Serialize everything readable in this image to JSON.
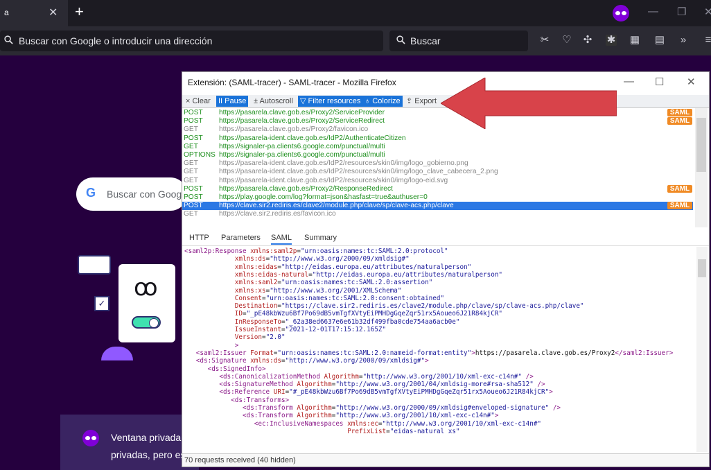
{
  "browser": {
    "tab_title": "a",
    "url_placeholder": "Buscar con Google o introducir una dirección",
    "search_placeholder": "Buscar"
  },
  "page": {
    "google_search_label": "Buscar con Goog",
    "private_notice_line1": "Ventana privada:",
    "private_notice_line2": "privadas, pero es"
  },
  "tracer": {
    "window_title": "Extensión: (SAML-tracer) - SAML-tracer - Mozilla Firefox",
    "toolbar": {
      "clear": "× Clear",
      "pause": "II Pause",
      "autoscroll": "± Autoscroll",
      "filter": "▽ Filter resources",
      "colorize": "♁ Colorize",
      "export": "⇪ Export"
    },
    "requests": [
      {
        "method": "POST",
        "url": "https://pasarela.clave.gob.es/Proxy2/ServiceProvider",
        "saml": true,
        "kind": "post"
      },
      {
        "method": "POST",
        "url": "https://pasarela.clave.gob.es/Proxy2/ServiceRedirect",
        "saml": true,
        "kind": "post"
      },
      {
        "method": "GET",
        "url": "https://pasarela.clave.gob.es/Proxy2/favicon.ico",
        "saml": false,
        "kind": "get"
      },
      {
        "method": "POST",
        "url": "https://pasarela-ident.clave.gob.es/IdP2/AuthenticateCitizen",
        "saml": false,
        "kind": "post"
      },
      {
        "method": "GET",
        "url": "https://signaler-pa.clients6.google.com/punctual/multi",
        "saml": false,
        "kind": "post"
      },
      {
        "method": "OPTIONS",
        "url": "https://signaler-pa.clients6.google.com/punctual/multi",
        "saml": false,
        "kind": "post"
      },
      {
        "method": "GET",
        "url": "https://pasarela-ident.clave.gob.es/IdP2/resources/skin0/img/logo_gobierno.png",
        "saml": false,
        "kind": "get"
      },
      {
        "method": "GET",
        "url": "https://pasarela-ident.clave.gob.es/IdP2/resources/skin0/img/logo_clave_cabecera_2.png",
        "saml": false,
        "kind": "get"
      },
      {
        "method": "GET",
        "url": "https://pasarela-ident.clave.gob.es/IdP2/resources/skin0/img/logo-eid.svg",
        "saml": false,
        "kind": "get"
      },
      {
        "method": "POST",
        "url": "https://pasarela.clave.gob.es/Proxy2/ResponseRedirect",
        "saml": true,
        "kind": "post"
      },
      {
        "method": "POST",
        "url": "https://play.google.com/log?format=json&hasfast=true&authuser=0",
        "saml": false,
        "kind": "post"
      },
      {
        "method": "POST",
        "url": "https://clave.sir2.rediris.es/clave2/module.php/clave/sp/clave-acs.php/clave",
        "saml": true,
        "kind": "sel"
      },
      {
        "method": "GET",
        "url": "https://clave.sir2.rediris.es/favicon.ico",
        "saml": false,
        "kind": "get"
      }
    ],
    "saml_badge": "SAML",
    "tabs": [
      "HTTP",
      "Parameters",
      "SAML",
      "Summary"
    ],
    "code_lines": [
      {
        "indent": 0,
        "parts": [
          [
            "tag",
            "<saml2p:Response "
          ],
          [
            "att",
            "xmlns:saml2p"
          ],
          [
            "txt",
            "="
          ],
          [
            "val",
            "\"urn:oasis:names:tc:SAML:2.0:protocol\""
          ]
        ]
      },
      {
        "indent": 13,
        "parts": [
          [
            "att",
            "xmlns:ds"
          ],
          [
            "txt",
            "="
          ],
          [
            "val",
            "\"http://www.w3.org/2000/09/xmldsig#\""
          ]
        ]
      },
      {
        "indent": 13,
        "parts": [
          [
            "att",
            "xmlns:eidas"
          ],
          [
            "txt",
            "="
          ],
          [
            "val",
            "\"http://eidas.europa.eu/attributes/naturalperson\""
          ]
        ]
      },
      {
        "indent": 13,
        "parts": [
          [
            "att",
            "xmlns:eidas-natural"
          ],
          [
            "txt",
            "="
          ],
          [
            "val",
            "\"http://eidas.europa.eu/attributes/naturalperson\""
          ]
        ]
      },
      {
        "indent": 13,
        "parts": [
          [
            "att",
            "xmlns:saml2"
          ],
          [
            "txt",
            "="
          ],
          [
            "val",
            "\"urn:oasis:names:tc:SAML:2.0:assertion\""
          ]
        ]
      },
      {
        "indent": 13,
        "parts": [
          [
            "att",
            "xmlns:xs"
          ],
          [
            "txt",
            "="
          ],
          [
            "val",
            "\"http://www.w3.org/2001/XMLSchema\""
          ]
        ]
      },
      {
        "indent": 13,
        "parts": [
          [
            "att",
            "Consent"
          ],
          [
            "txt",
            "="
          ],
          [
            "val",
            "\"urn:oasis:names:tc:SAML:2.0:consent:obtained\""
          ]
        ]
      },
      {
        "indent": 13,
        "parts": [
          [
            "att",
            "Destination"
          ],
          [
            "txt",
            "="
          ],
          [
            "val",
            "\"https://clave.sir2.rediris.es/clave2/module.php/clave/sp/clave-acs.php/clave\""
          ]
        ]
      },
      {
        "indent": 13,
        "parts": [
          [
            "att",
            "ID"
          ],
          [
            "txt",
            "="
          ],
          [
            "val",
            "\"_pE48kbWzu6Bf7Po69dB5vmTgfXVtyEiPMHDgGqeZqr51rx5Aoueo6J21R84kjCR\""
          ]
        ]
      },
      {
        "indent": 13,
        "parts": [
          [
            "att",
            "InResponseTo"
          ],
          [
            "txt",
            "="
          ],
          [
            "val",
            "\"_62a38ed6637e6e61b32df499fba0cde754aa6acb0e\""
          ]
        ]
      },
      {
        "indent": 13,
        "parts": [
          [
            "att",
            "IssueInstant"
          ],
          [
            "txt",
            "="
          ],
          [
            "val",
            "\"2021-12-01T17:15:12.165Z\""
          ]
        ]
      },
      {
        "indent": 13,
        "parts": [
          [
            "att",
            "Version"
          ],
          [
            "txt",
            "="
          ],
          [
            "val",
            "\"2.0\""
          ]
        ]
      },
      {
        "indent": 13,
        "parts": [
          [
            "tag",
            ">"
          ]
        ]
      },
      {
        "indent": 3,
        "parts": [
          [
            "tag",
            "<saml2:Issuer "
          ],
          [
            "att",
            "Format"
          ],
          [
            "txt",
            "="
          ],
          [
            "val",
            "\"urn:oasis:names:tc:SAML:2.0:nameid-format:entity\""
          ],
          [
            "tag",
            ">"
          ],
          [
            "txt",
            "https://pasarela.clave.gob.es/Proxy2"
          ],
          [
            "tag",
            "</saml2:Issuer>"
          ]
        ]
      },
      {
        "indent": 3,
        "parts": [
          [
            "tag",
            "<ds:Signature "
          ],
          [
            "att",
            "xmlns:ds"
          ],
          [
            "txt",
            "="
          ],
          [
            "val",
            "\"http://www.w3.org/2000/09/xmldsig#\""
          ],
          [
            "tag",
            ">"
          ]
        ]
      },
      {
        "indent": 6,
        "parts": [
          [
            "tag",
            "<ds:SignedInfo>"
          ]
        ]
      },
      {
        "indent": 9,
        "parts": [
          [
            "tag",
            "<ds:CanonicalizationMethod "
          ],
          [
            "att",
            "Algorithm"
          ],
          [
            "txt",
            "="
          ],
          [
            "val",
            "\"http://www.w3.org/2001/10/xml-exc-c14n#\""
          ],
          [
            "tag",
            " />"
          ]
        ]
      },
      {
        "indent": 9,
        "parts": [
          [
            "tag",
            "<ds:SignatureMethod "
          ],
          [
            "att",
            "Algorithm"
          ],
          [
            "txt",
            "="
          ],
          [
            "val",
            "\"http://www.w3.org/2001/04/xmldsig-more#rsa-sha512\""
          ],
          [
            "tag",
            " />"
          ]
        ]
      },
      {
        "indent": 9,
        "parts": [
          [
            "tag",
            "<ds:Reference "
          ],
          [
            "att",
            "URI"
          ],
          [
            "txt",
            "="
          ],
          [
            "val",
            "\"#_pE48kbWzu6Bf7Po69dB5vmTgfXVtyEiPMHDgGqeZqr51rx5Aoueo6J21R84kjCR\""
          ],
          [
            "tag",
            ">"
          ]
        ]
      },
      {
        "indent": 12,
        "parts": [
          [
            "tag",
            "<ds:Transforms>"
          ]
        ]
      },
      {
        "indent": 15,
        "parts": [
          [
            "tag",
            "<ds:Transform "
          ],
          [
            "att",
            "Algorithm"
          ],
          [
            "txt",
            "="
          ],
          [
            "val",
            "\"http://www.w3.org/2000/09/xmldsig#enveloped-signature\""
          ],
          [
            "tag",
            " />"
          ]
        ]
      },
      {
        "indent": 15,
        "parts": [
          [
            "tag",
            "<ds:Transform "
          ],
          [
            "att",
            "Algorithm"
          ],
          [
            "txt",
            "="
          ],
          [
            "val",
            "\"http://www.w3.org/2001/10/xml-exc-c14n#\""
          ],
          [
            "tag",
            ">"
          ]
        ]
      },
      {
        "indent": 18,
        "parts": [
          [
            "tag",
            "<ec:InclusiveNamespaces "
          ],
          [
            "att",
            "xmlns:ec"
          ],
          [
            "txt",
            "="
          ],
          [
            "val",
            "\"http://www.w3.org/2001/10/xml-exc-c14n#\""
          ]
        ]
      },
      {
        "indent": 42,
        "parts": [
          [
            "att",
            "PrefixList"
          ],
          [
            "txt",
            "="
          ],
          [
            "val",
            "\"eidas-natural xs\""
          ]
        ]
      }
    ],
    "status": "70 requests received (40 hidden)"
  },
  "colors": {
    "page_bg": "#25003e",
    "saml_badge": "#f08a24",
    "selected_row": "#2b78e4",
    "post_text": "#1e8f1e",
    "arrow": "#d8434a"
  }
}
